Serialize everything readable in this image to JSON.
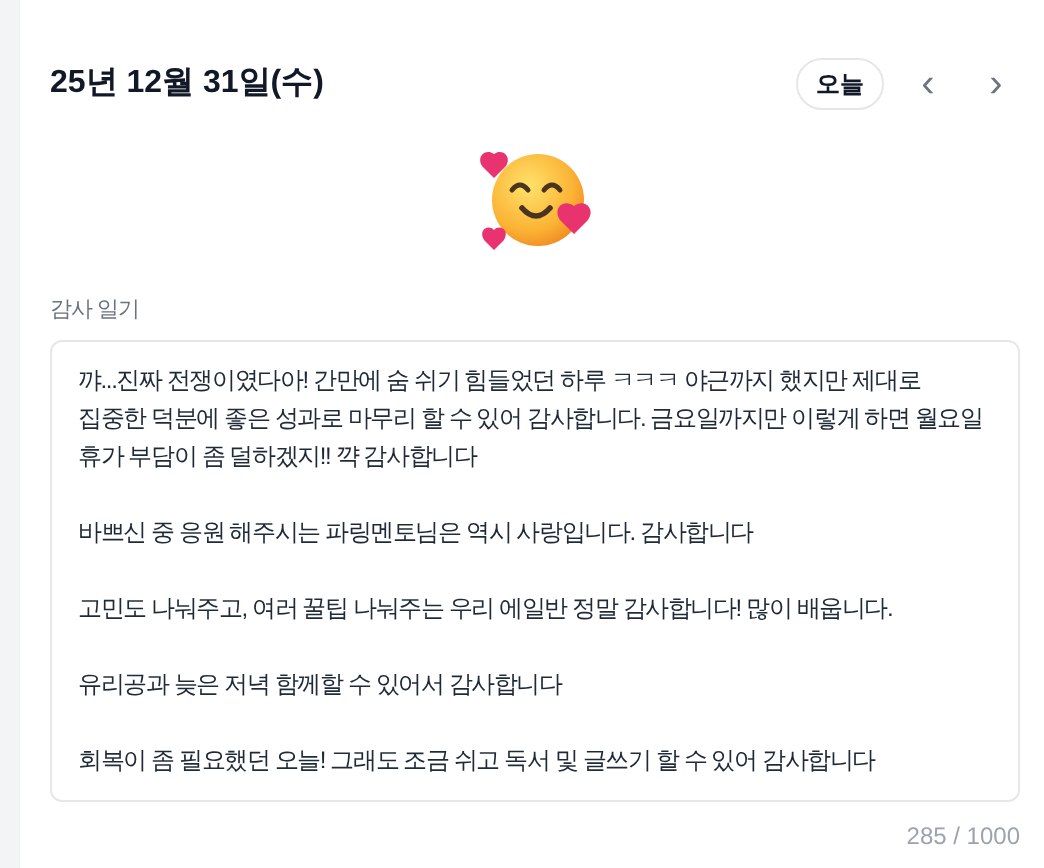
{
  "header": {
    "date": "25년 12월 31일(수)",
    "today_button": "오늘",
    "prev_button": "‹",
    "next_button": "›"
  },
  "diary": {
    "label": "감사 일기",
    "value": "꺄...진짜 전쟁이였다아! 간만에 숨 쉬기 힘들었던 하루 ㅋㅋㅋ 야근까지 했지만 제대로 집중한 덕분에 좋은 성과로 마무리 할 수 있어 감사합니다. 금요일까지만 이렇게 하면 월요일 휴가 부담이 좀 덜하겠지!! 꺅 감사합니다\n\n바쁘신 중 응원 해주시는 파링멘토님은 역시 사랑입니다. 감사합니다\n\n고민도 나눠주고, 여러 꿀팁 나눠주는 우리 에일반 정말 감사합니다! 많이 배웁니다.\n\n유리공과 늦은 저녁 함께할 수 있어서 감사합니다\n\n회복이 좀 필요했던 오늘! 그래도 조금 쉬고 독서 및 글쓰기 할 수 있어 감사합니다",
    "counter": "285 / 1000"
  }
}
